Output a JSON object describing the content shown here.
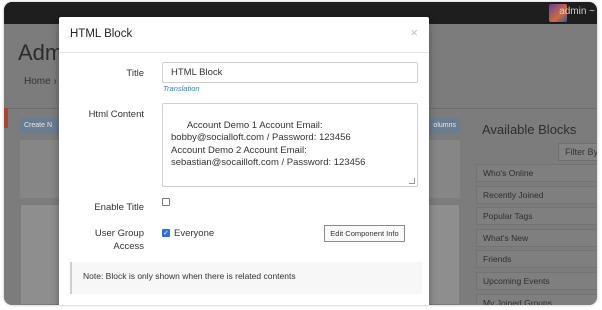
{
  "topbar": {
    "user_label": "admin ~"
  },
  "page": {
    "title": "Adm",
    "breadcrumb": "Home ›",
    "create_button": "Create N",
    "columns_button": "olumns"
  },
  "sidebar": {
    "title": "Available Blocks",
    "filter_label": "Filter By ˅",
    "blocks": [
      {
        "label": "Who's Online"
      },
      {
        "label": "Recently Joined"
      },
      {
        "label": "Popular Tags"
      },
      {
        "label": "What's New"
      },
      {
        "label": "Friends"
      },
      {
        "label": "Upcoming Events"
      },
      {
        "label": "My Joined Groups"
      }
    ]
  },
  "modal": {
    "title": "HTML Block",
    "close_icon": "×",
    "fields": {
      "title_label": "Title",
      "title_value": "HTML Block",
      "translation_link": "Translation",
      "content_label": "Html Content",
      "content_value": "Account Demo 1 Account Email: bobby@socialloft.com / Password: 123456\nAccount Demo 2 Account Email: sebastian@socailloft.com / Password: 123456",
      "enable_title_label": "Enable Title",
      "enable_title_checked": false,
      "user_group_label_1": "User Group",
      "user_group_label_2": "Access",
      "everyone_label": "Everyone",
      "everyone_checked": true,
      "edit_component_button": "Edit Component Info"
    },
    "note": "Note: Block is only shown when there is related contents"
  }
}
